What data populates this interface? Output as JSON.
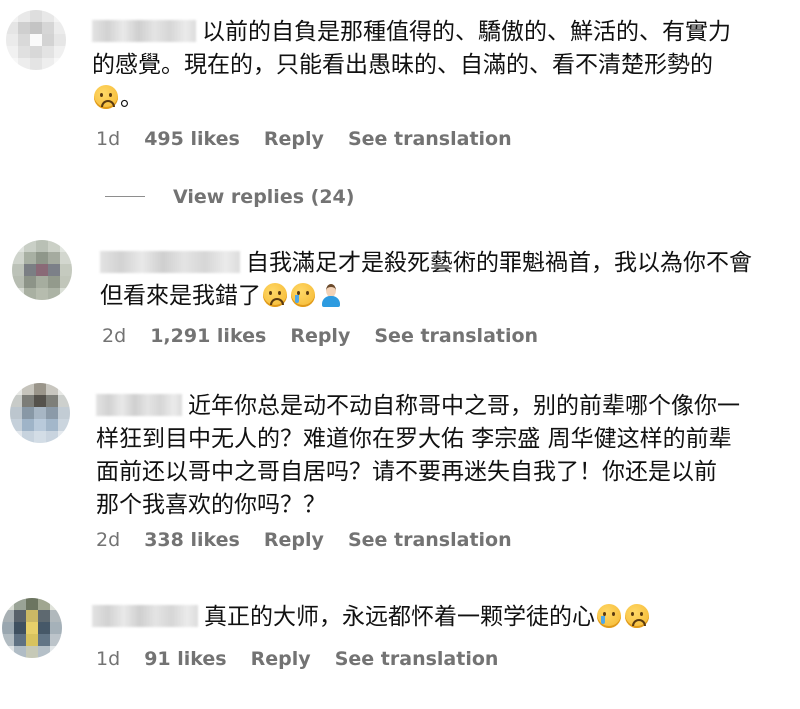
{
  "comments": [
    {
      "lines": [
        "以前的自負是那種值得的、驕傲的、鮮活的、有實力",
        "的感覺。現在的，只能看出愚昧的、自滿的、看不清楚形勢的",
        "。"
      ],
      "time": "1d",
      "likes": "495 likes",
      "reply": "Reply",
      "translate": "See translation"
    },
    {
      "lines": [
        "自我滿足才是殺死藝術的罪魁禍首，我以為你不會",
        "但看來是我錯了"
      ],
      "time": "2d",
      "likes": "1,291 likes",
      "reply": "Reply",
      "translate": "See translation"
    },
    {
      "lines": [
        "近年你总是动不动自称哥中之哥，别的前辈哪个像你一",
        "样狂到目中无人的？难道你在罗大佑 李宗盛 周华健这样的前辈",
        "面前还以哥中之哥自居吗？请不要再迷失自我了！你还是以前",
        "那个我喜欢的你吗？？"
      ],
      "time": "2d",
      "likes": "338 likes",
      "reply": "Reply",
      "translate": "See translation"
    },
    {
      "lines": [
        "真正的大师，永远都怀着一颗学徒的心"
      ],
      "time": "1d",
      "likes": "91 likes",
      "reply": "Reply",
      "translate": "See translation"
    }
  ],
  "view_replies": "View replies (24)",
  "icons": {
    "emoji_sad": "pleading-face-emoji",
    "emoji_cry": "crying-face-emoji",
    "emoji_person": "person-facepalming-emoji"
  }
}
